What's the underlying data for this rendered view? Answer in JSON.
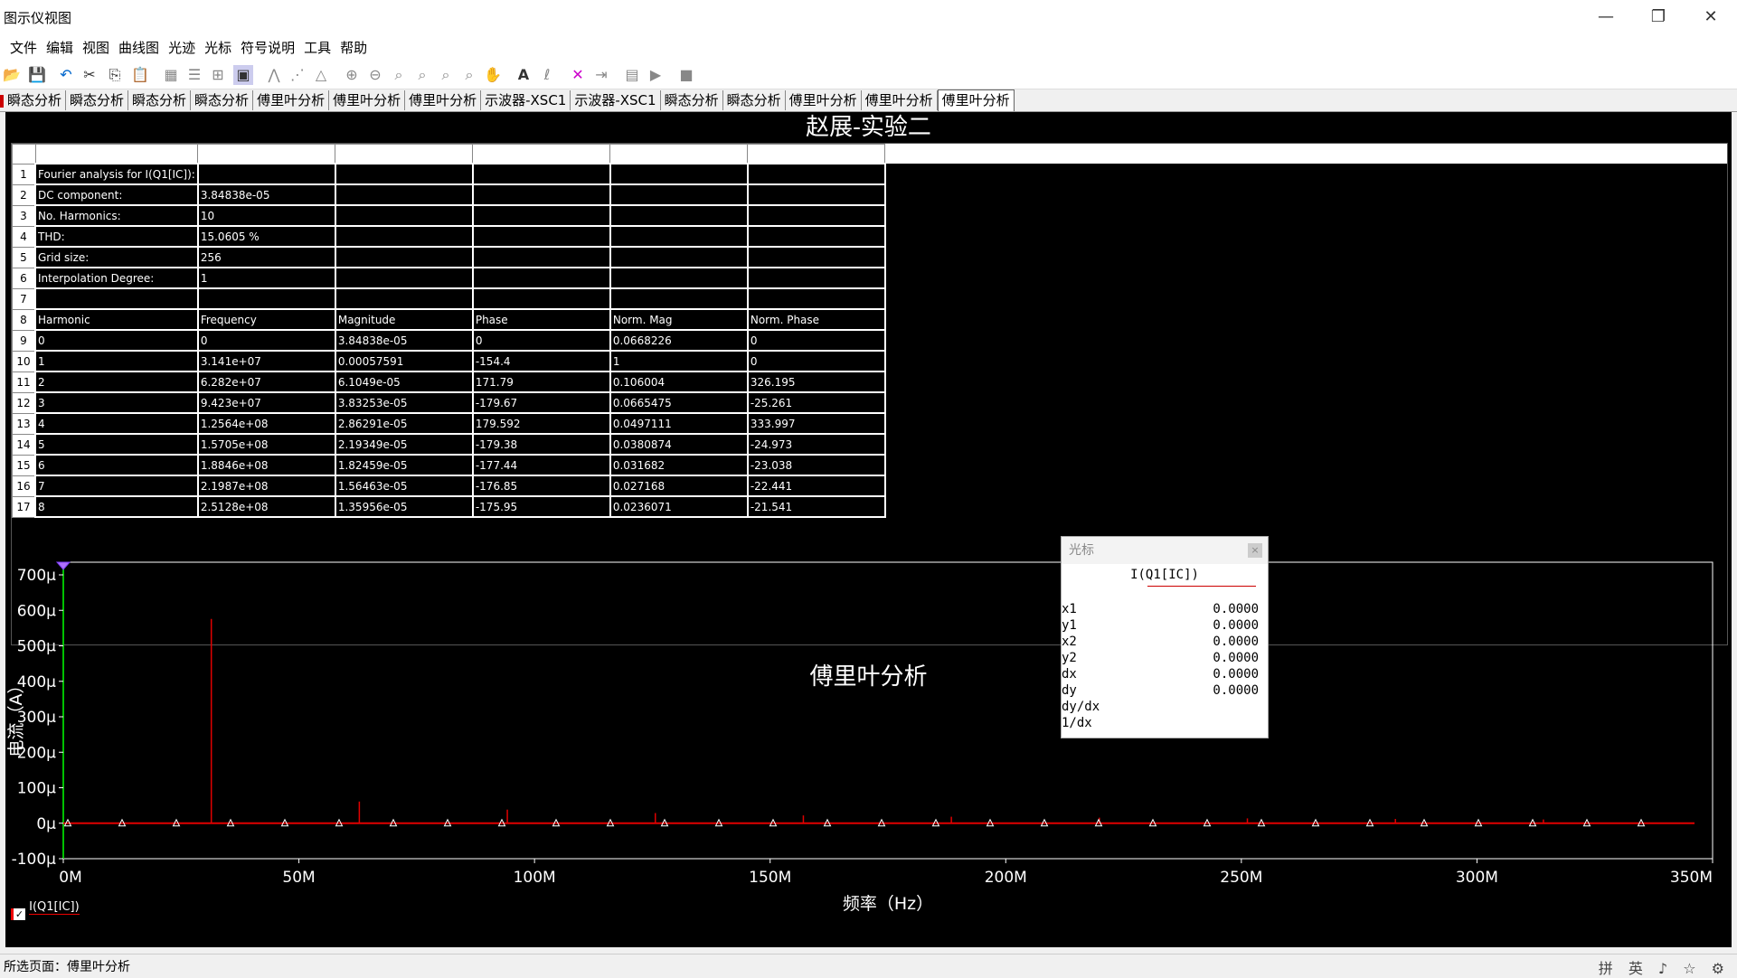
{
  "window": {
    "title": "图示仪视图",
    "minimize_label": "—",
    "restore_label": "❐",
    "close_label": "✕"
  },
  "menu": [
    "文件",
    "编辑",
    "视图",
    "曲线图",
    "光迹",
    "光标",
    "符号说明",
    "工具",
    "帮助"
  ],
  "tabs": [
    "瞬态分析",
    "瞬态分析",
    "瞬态分析",
    "瞬态分析",
    "傅里叶分析",
    "傅里叶分析",
    "傅里叶分析",
    "示波器-XSC1",
    "示波器-XSC1",
    "瞬态分析",
    "瞬态分析",
    "傅里叶分析",
    "傅里叶分析",
    "傅里叶分析"
  ],
  "active_tab_index": 13,
  "table": {
    "title": "赵展-实验二",
    "rows": [
      [
        "Fourier analysis for I(Q1[IC]):",
        "",
        "",
        "",
        "",
        ""
      ],
      [
        "DC component:",
        "3.84838e-05",
        "",
        "",
        "",
        ""
      ],
      [
        "No. Harmonics:",
        "10",
        "",
        "",
        "",
        ""
      ],
      [
        "THD:",
        "15.0605 %",
        "",
        "",
        "",
        ""
      ],
      [
        "Grid size:",
        "256",
        "",
        "",
        "",
        ""
      ],
      [
        "Interpolation Degree:",
        "1",
        "",
        "",
        "",
        ""
      ],
      [
        "",
        "",
        "",
        "",
        "",
        ""
      ],
      [
        "Harmonic",
        "Frequency",
        "Magnitude",
        "Phase",
        "Norm. Mag",
        "Norm. Phase"
      ],
      [
        "0",
        "0",
        "3.84838e-05",
        "0",
        "0.0668226",
        "0"
      ],
      [
        "1",
        "3.141e+07",
        "0.00057591",
        "-154.4",
        "1",
        "0"
      ],
      [
        "2",
        "6.282e+07",
        "6.1049e-05",
        "171.79",
        "0.106004",
        "326.195"
      ],
      [
        "3",
        "9.423e+07",
        "3.83253e-05",
        "-179.67",
        "0.0665475",
        "-25.261"
      ],
      [
        "4",
        "1.2564e+08",
        "2.86291e-05",
        "179.592",
        "0.0497111",
        "333.997"
      ],
      [
        "5",
        "1.5705e+08",
        "2.19349e-05",
        "-179.38",
        "0.0380874",
        "-24.973"
      ],
      [
        "6",
        "1.8846e+08",
        "1.82459e-05",
        "-177.44",
        "0.031682",
        "-23.038"
      ],
      [
        "7",
        "2.1987e+08",
        "1.56463e-05",
        "-176.85",
        "0.027168",
        "-22.441"
      ],
      [
        "8",
        "2.5128e+08",
        "1.35956e-05",
        "-175.95",
        "0.0236071",
        "-21.541"
      ]
    ]
  },
  "chart_data": {
    "type": "bar",
    "title": "傅里叶分析",
    "xlabel": "频率（Hz）",
    "ylabel": "电流（A）",
    "xlim": [
      0,
      350000000
    ],
    "ylim": [
      -0.0001,
      0.0007
    ],
    "xticks": [
      "0M",
      "50M",
      "100M",
      "150M",
      "200M",
      "250M",
      "300M",
      "350M"
    ],
    "yticks": [
      "700μ",
      "600μ",
      "500μ",
      "400μ",
      "300μ",
      "200μ",
      "100μ",
      "0μ",
      "-100μ"
    ],
    "series": [
      {
        "name": "I(Q1[IC])",
        "color": "#e00000",
        "x": [
          31410000,
          62820000,
          94230000,
          125640000,
          157050000,
          188460000,
          219870000,
          251280000,
          282690000,
          314100000
        ],
        "values": [
          0.00057591,
          6.1049e-05,
          3.83253e-05,
          2.86291e-05,
          2.19349e-05,
          1.82459e-05,
          1.56463e-05,
          1.35956e-05,
          1.2e-05,
          1.05e-05
        ]
      }
    ]
  },
  "cursor": {
    "header": "光标",
    "close": "×",
    "signal": "I(Q1[IC])",
    "rows": [
      {
        "k": "x1",
        "v": "0.0000"
      },
      {
        "k": "y1",
        "v": "0.0000"
      },
      {
        "k": "x2",
        "v": "0.0000"
      },
      {
        "k": "y2",
        "v": "0.0000"
      },
      {
        "k": "dx",
        "v": "0.0000"
      },
      {
        "k": "dy",
        "v": "0.0000"
      },
      {
        "k": "dy/dx",
        "v": ""
      },
      {
        "k": "1/dx",
        "v": ""
      }
    ]
  },
  "legend": {
    "label": "I(Q1[IC])",
    "checked": true
  },
  "status": {
    "text": "所选页面：傅里叶分析",
    "ime": "拼 英 ♪ ☆ ⚙"
  }
}
